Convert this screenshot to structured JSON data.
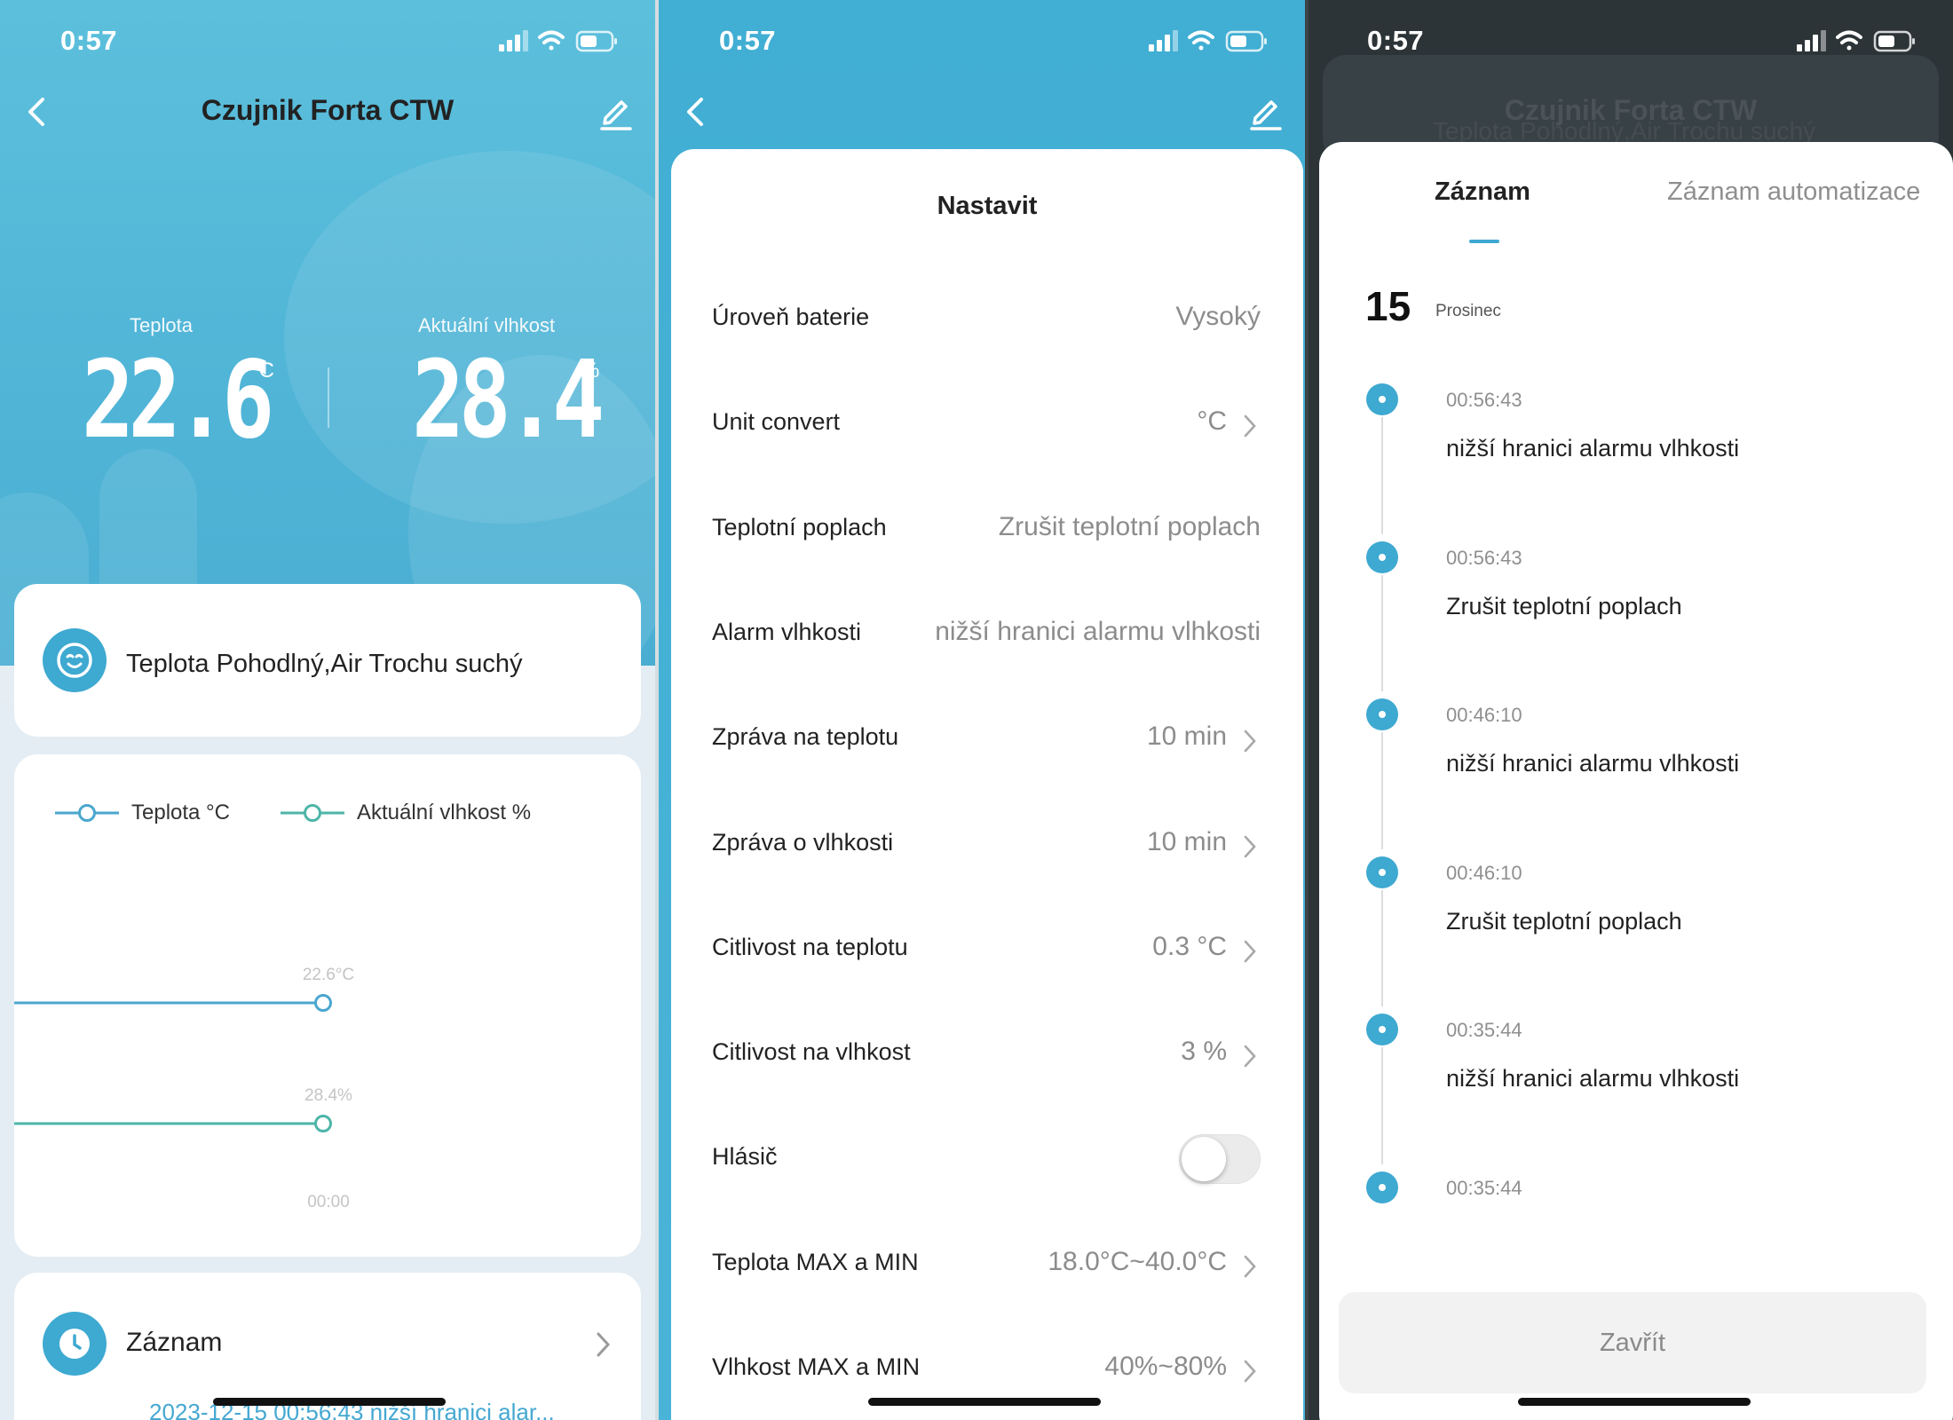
{
  "status_bar": {
    "time": "0:57"
  },
  "device_screen": {
    "title": "Czujnik Forta CTW",
    "temperature": {
      "label": "Teplota",
      "value": "22.6",
      "unit": "°C"
    },
    "humidity": {
      "label": "Aktuální vlhkost",
      "value": "28.4",
      "unit": "%"
    },
    "comfort": {
      "text": "Teplota Pohodlný,Air Trochu suchý"
    },
    "chart_data": {
      "type": "line",
      "title": "",
      "x": [
        "00:00"
      ],
      "series": [
        {
          "name": "Teplota °C",
          "values": [
            22.6
          ],
          "data_label": "22.6°C",
          "color": "#4ba7cf"
        },
        {
          "name": "Aktuální vlhkost %",
          "values": [
            28.4
          ],
          "data_label": "28.4%",
          "color": "#4db5a8"
        }
      ],
      "xlabel": "",
      "ylabel": "",
      "legend": "top-left",
      "grid": false
    },
    "record": {
      "label": "Záznam",
      "preview": "2023-12-15 00:56:43 nižší hranici alar..."
    }
  },
  "settings_sheet": {
    "title": "Nastavit",
    "rows": [
      {
        "label": "Úroveň baterie",
        "value": "Vysoký",
        "chevron": false
      },
      {
        "label": "Unit convert",
        "value": "°C",
        "chevron": true
      },
      {
        "label": "Teplotní poplach",
        "value": "Zrušit teplotní poplach",
        "chevron": false
      },
      {
        "label": "Alarm vlhkosti",
        "value": "nižší hranici alarmu vlhkosti",
        "chevron": false
      },
      {
        "label": "Zpráva na teplotu",
        "value": "10 min",
        "chevron": true
      },
      {
        "label": "Zpráva o vlhkosti",
        "value": "10 min",
        "chevron": true
      },
      {
        "label": "Citlivost na teplotu",
        "value": "0.3 °C",
        "chevron": true
      },
      {
        "label": "Citlivost na vlhkost",
        "value": "3 %",
        "chevron": true
      },
      {
        "label": "Hlásič",
        "value": "",
        "toggle": true,
        "toggle_on": false
      },
      {
        "label": "Teplota MAX a MIN",
        "value": "18.0°C~40.0°C",
        "chevron": true
      },
      {
        "label": "Vlhkost MAX a MIN",
        "value": "40%~80%",
        "chevron": true
      }
    ]
  },
  "records_sheet": {
    "background_title": "Czujnik Forta CTW",
    "background_subtitle": "Teplota Pohodlný,Air Trochu suchý",
    "tabs": [
      {
        "label": "Záznam",
        "active": true
      },
      {
        "label": "Záznam automatizace",
        "active": false
      }
    ],
    "date_day": "15",
    "date_month": "Prosinec",
    "entries": [
      {
        "time": "00:56:43",
        "text": "nižší hranici alarmu vlhkosti"
      },
      {
        "time": "00:56:43",
        "text": "Zrušit teplotní poplach"
      },
      {
        "time": "00:46:10",
        "text": "nižší hranici alarmu vlhkosti"
      },
      {
        "time": "00:46:10",
        "text": "Zrušit teplotní poplach"
      },
      {
        "time": "00:35:44",
        "text": "nižší hranici alarmu vlhkosti"
      },
      {
        "time": "00:35:44",
        "text": ""
      }
    ],
    "close_label": "Zavřít"
  },
  "colors": {
    "accent": "#3ea9d1",
    "humidity_line": "#4db5a8",
    "header_blue": "#4ab4d8"
  },
  "icons": [
    "back-icon",
    "edit-icon",
    "smiley-icon",
    "clock-icon",
    "chevron-right-icon",
    "signal-icon",
    "wifi-icon",
    "battery-icon"
  ]
}
